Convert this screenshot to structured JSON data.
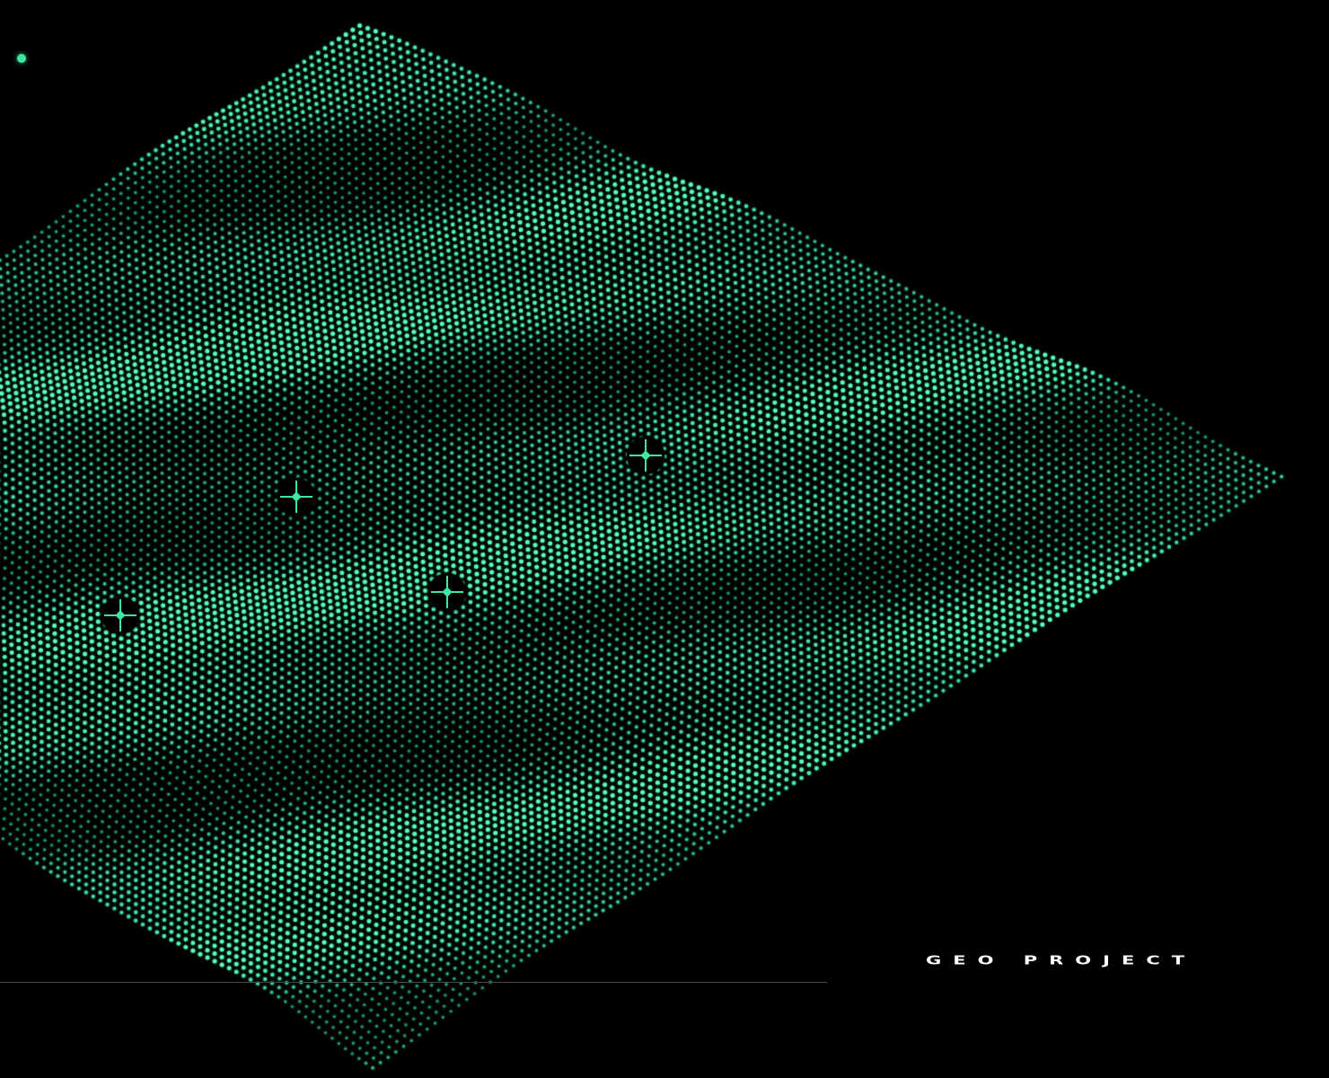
{
  "app": {
    "title": "GEO PROJECT"
  },
  "colors": {
    "background": "#000000",
    "accent": "#3ee6a2",
    "text": "#ffffff",
    "divider": "#4a4a4a"
  },
  "status_indicator": {
    "icon": "status-dot-icon",
    "color": "#3ee6a2"
  },
  "map": {
    "type": "dotted terrain point cloud",
    "markers": [
      {
        "icon": "crosshair-icon"
      },
      {
        "icon": "crosshair-icon"
      },
      {
        "icon": "crosshair-icon"
      },
      {
        "icon": "crosshair-icon"
      }
    ]
  }
}
